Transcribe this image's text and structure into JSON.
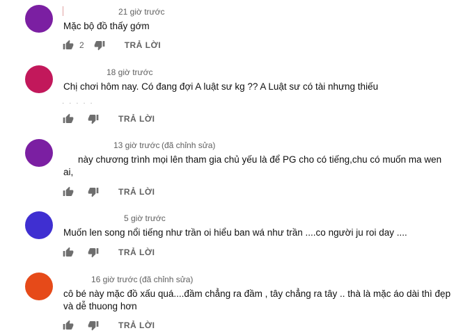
{
  "comments": [
    {
      "time": "21 giờ trước",
      "edited": "",
      "text": "Mặc bộ đồ thấy gớm",
      "likes": "2",
      "reply_label": "TRẢ LỜI",
      "avatar_color": "#7b1fa2"
    },
    {
      "time": "18 giờ trước",
      "edited": "",
      "text": "Chị chơi hôm nay. Có đang đợi A luật sư kg ?? A Luật sư có tài nhưng thiếu",
      "likes": "",
      "reply_label": "TRẢ LỜI",
      "avatar_color": "#c2185b"
    },
    {
      "time": "13 giờ trước",
      "edited": "(đã chỉnh sửa)",
      "text": "này chương trình mọi lên tham gia chủ yếu là để PG cho có tiếng,chu có muốn ma wen",
      "text_line2": "ai,",
      "likes": "",
      "reply_label": "TRẢ LỜI",
      "avatar_color": "#7b1fa2"
    },
    {
      "time": "5 giờ trước",
      "edited": "",
      "text": "Muốn len song nổi tiếng như trần oi hiểu ban wá như trần ....co người ju roi day ....",
      "likes": "",
      "reply_label": "TRẢ LỜI",
      "avatar_color": "#3f2fd1"
    },
    {
      "time": "16 giờ trước",
      "edited": "(đã chỉnh sửa)",
      "text": "cô bé này mặc đồ xấu quá....đầm chẳng ra đầm , tây chẳng ra tây .. thà là mặc áo dài  thì đẹp",
      "text_line2": "và dễ thuong hơn",
      "likes": "",
      "reply_label": "TRẢ LỜI",
      "avatar_color": "#e64a19"
    }
  ],
  "icons": {
    "like": "thumb-up-icon",
    "dislike": "thumb-down-icon"
  }
}
